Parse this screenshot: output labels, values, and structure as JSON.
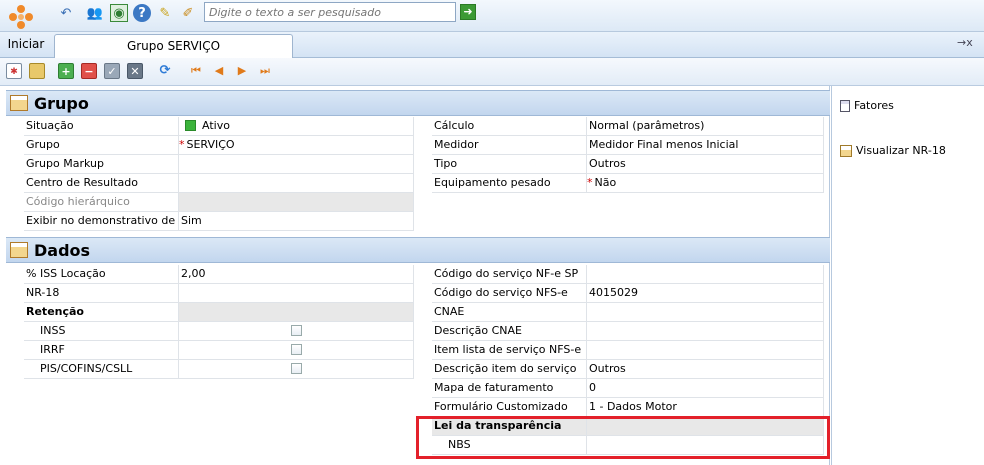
{
  "toolbar_top": {
    "search_placeholder": "Digite o texto a ser pesquisado",
    "icons": [
      "app-logo-icon",
      "undo-icon",
      "users-icon",
      "eye-icon",
      "help-icon",
      "broom-icon",
      "edit-note-icon",
      "go-arrow-icon"
    ]
  },
  "tabs": {
    "home_label": "Iniciar",
    "active_tab_label": "Grupo SERVIÇO",
    "pin_label": "→x"
  },
  "grupo": {
    "title": "Grupo",
    "left_rows": [
      {
        "label": "Situação",
        "value": "Ativo"
      },
      {
        "label": "Grupo",
        "value": "SERVIÇO",
        "required": "*"
      },
      {
        "label": "Grupo Markup",
        "value": ""
      },
      {
        "label": "Centro de Resultado",
        "value": ""
      },
      {
        "label": "Código hierárquico",
        "value": ""
      },
      {
        "label": "Exibir no demonstrativo de fatu",
        "value": "Sim"
      }
    ],
    "right_rows": [
      {
        "label": "Cálculo",
        "value": "Normal (parâmetros)"
      },
      {
        "label": "Medidor",
        "value": "Medidor Final menos Inicial"
      },
      {
        "label": "Tipo",
        "value": "Outros"
      },
      {
        "label": "Equipamento pesado",
        "value": "Não",
        "required": "*"
      }
    ]
  },
  "dados": {
    "title": "Dados",
    "left_rows": [
      {
        "label": "% ISS Locação",
        "value": "2,00"
      },
      {
        "label": "NR-18",
        "value": ""
      },
      {
        "label": "Retenção",
        "value": ""
      },
      {
        "label": "INSS",
        "value": ""
      },
      {
        "label": "IRRF",
        "value": ""
      },
      {
        "label": "PIS/COFINS/CSLL",
        "value": ""
      }
    ],
    "right_rows": [
      {
        "label": "Código do serviço NF-e SP",
        "value": ""
      },
      {
        "label": "Código do serviço NFS-e",
        "value": "4015029"
      },
      {
        "label": "CNAE",
        "value": ""
      },
      {
        "label": "Descrição CNAE",
        "value": ""
      },
      {
        "label": "Item lista de serviço NFS-e",
        "value": ""
      },
      {
        "label": "Descrição item do serviço",
        "value": "Outros"
      },
      {
        "label": "Mapa de faturamento",
        "value": "0"
      },
      {
        "label": "Formulário Customizado",
        "value": "1 - Dados Motor"
      },
      {
        "label": "Lei da transparência",
        "value": ""
      },
      {
        "label": "NBS",
        "value": ""
      }
    ]
  },
  "sidebar": {
    "items": [
      {
        "label": "Fatores"
      },
      {
        "label": "Visualizar NR-18"
      }
    ]
  },
  "colors": {
    "highlight": "#e3202a",
    "status_active": "#3cb43c",
    "section_bg": "#c9dbef"
  }
}
